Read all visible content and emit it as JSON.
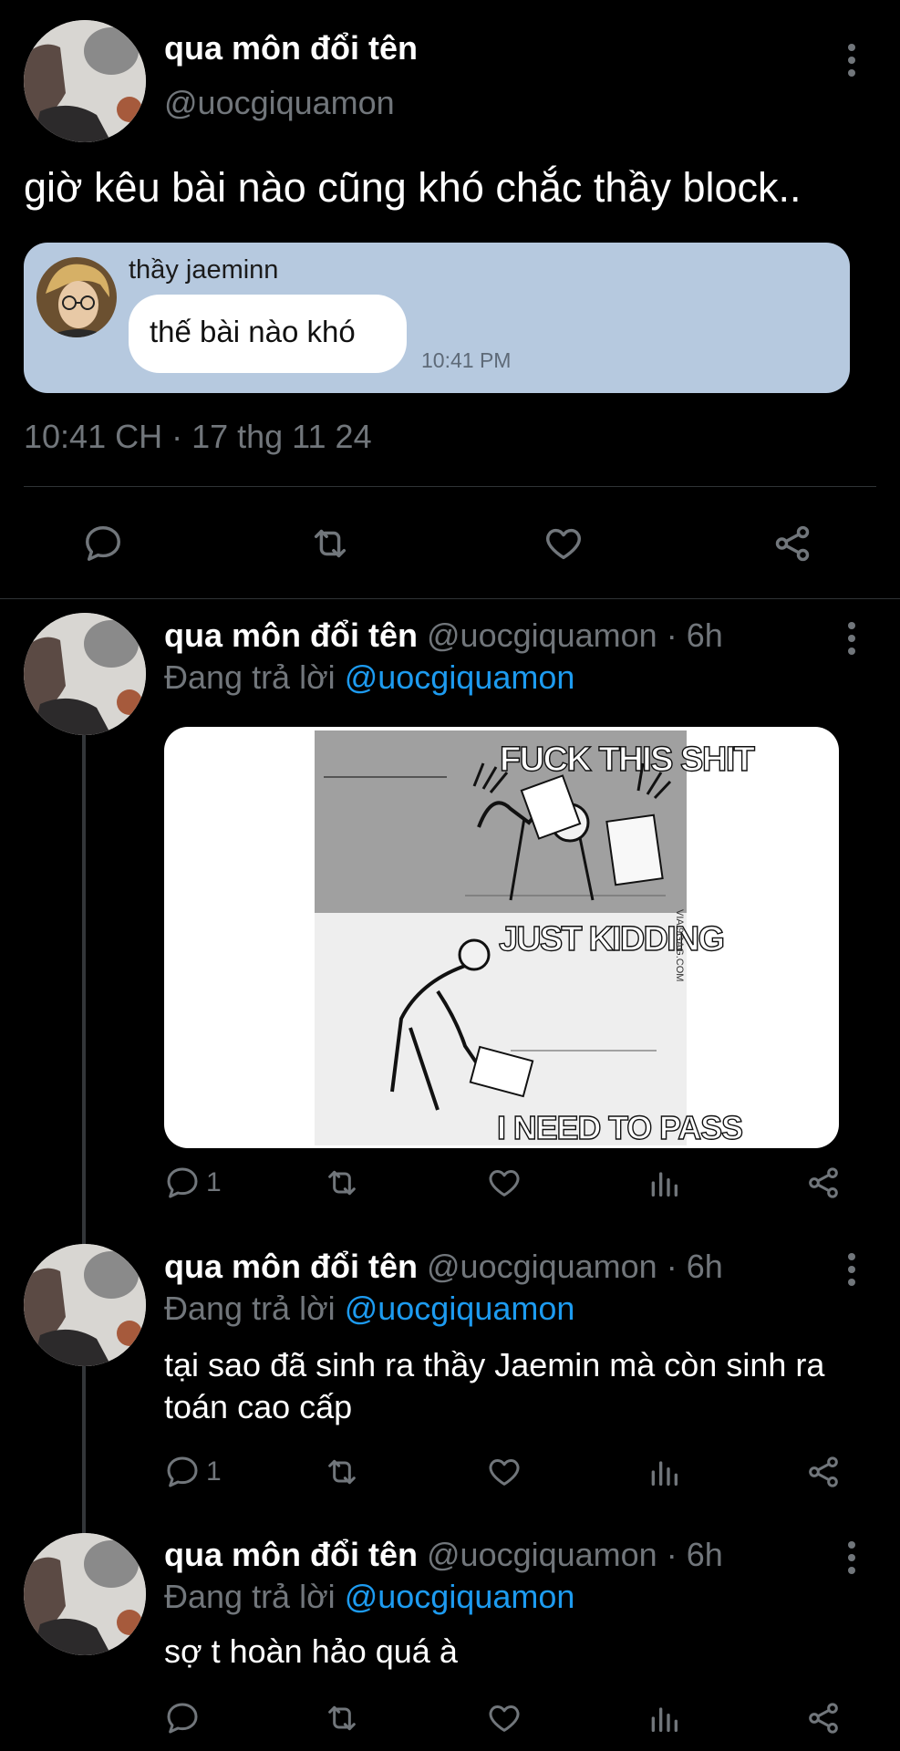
{
  "main_tweet": {
    "display_name": "qua môn đổi tên",
    "handle": "@uocgiquamon",
    "text": "giờ kêu bài nào cũng khó chắc thầy block..",
    "embedded_chat": {
      "sender_name": "thầy jaeminn",
      "message": "thế bài nào khó",
      "time": "10:41 PM"
    },
    "timestamp": "10:41 CH · 17 thg 11 24"
  },
  "replies": [
    {
      "display_name": "qua môn đổi tên",
      "handle": "@uocgiquamon",
      "age": "· 6h",
      "replying_prefix": "Đang trả lời",
      "replying_to": "@uocgiquamon",
      "meme": {
        "top_text": "FUCK THIS SHIT",
        "middle_text": "JUST KIDDING",
        "bottom_text": "I NEED TO PASS",
        "watermark": "VIA 9GAG.COM"
      },
      "reply_count": "1"
    },
    {
      "display_name": "qua môn đổi tên",
      "handle": "@uocgiquamon",
      "age": "· 6h",
      "replying_prefix": "Đang trả lời",
      "replying_to": "@uocgiquamon",
      "text": "tại sao đã sinh ra thầy Jaemin mà còn sinh ra toán cao cấp",
      "reply_count": "1"
    },
    {
      "display_name": "qua môn đổi tên",
      "handle": "@uocgiquamon",
      "age": "· 6h",
      "replying_prefix": "Đang trả lời",
      "replying_to": "@uocgiquamon",
      "text": "sợ t hoàn hảo quá à",
      "reply_count": ""
    }
  ],
  "icons": [
    "more-icon",
    "reply-icon",
    "retweet-icon",
    "like-icon",
    "views-icon",
    "share-icon"
  ],
  "colors": {
    "background": "#000000",
    "text": "#e7e9ea",
    "secondary_text": "#71767b",
    "link": "#1d9bf0",
    "chat_card": "#b6c9df"
  }
}
